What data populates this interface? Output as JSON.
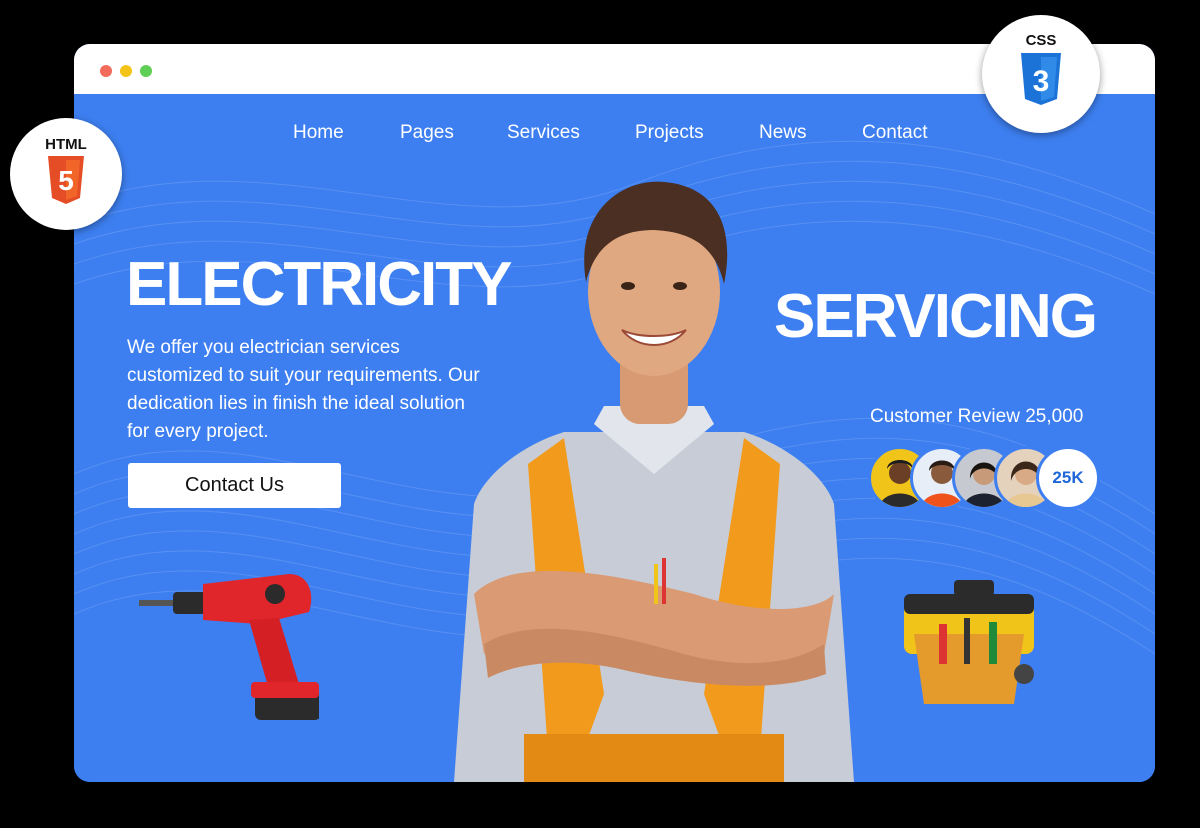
{
  "window": {
    "controls": [
      "close-dot",
      "minimize-dot",
      "maximize-dot"
    ]
  },
  "nav": {
    "items": [
      {
        "label": "Home"
      },
      {
        "label": "Pages"
      },
      {
        "label": "Services"
      },
      {
        "label": "Projects"
      },
      {
        "label": "News"
      },
      {
        "label": "Contact"
      }
    ]
  },
  "hero": {
    "headline_left": "ELECTRICITY",
    "headline_right": "SERVICING",
    "description": "We offer you electrician services customized to suit your requirements. Our dedication lies in finish the ideal solution for every project.",
    "cta_label": "Contact Us"
  },
  "reviews": {
    "label": "Customer Review 25,000",
    "badge": "25K",
    "avatars": [
      "avatar-1",
      "avatar-2",
      "avatar-3",
      "avatar-4"
    ]
  },
  "badges": {
    "html_label": "HTML",
    "html_digit": "5",
    "css_label": "CSS",
    "css_digit": "3"
  },
  "colors": {
    "hero_bg": "#3d7ff0",
    "html5_orange": "#e44d26",
    "css3_blue": "#1b73d8",
    "cta_bg": "#ffffff"
  }
}
